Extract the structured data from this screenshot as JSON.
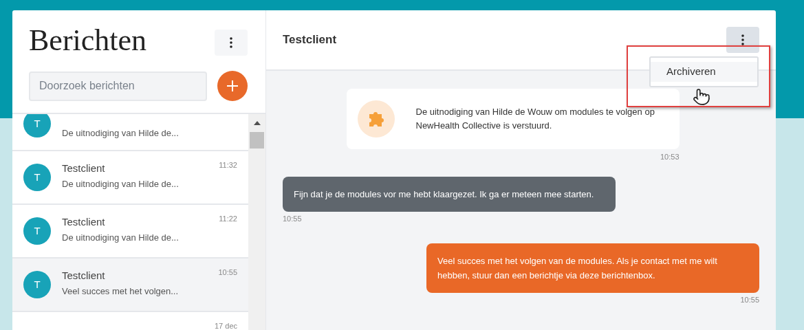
{
  "sidebar": {
    "title": "Berichten",
    "search": {
      "placeholder": "Doorzoek berichten"
    },
    "conversations": [
      {
        "avatar": "T",
        "preview": "De uitnodiging van Hilde de...",
        "selected": false
      },
      {
        "avatar": "T",
        "name": "Testclient",
        "preview": "De uitnodiging van Hilde de...",
        "time": "11:32",
        "selected": false
      },
      {
        "avatar": "T",
        "name": "Testclient",
        "preview": "De uitnodiging van Hilde de...",
        "time": "11:22",
        "selected": false
      },
      {
        "avatar": "T",
        "name": "Testclient",
        "preview": "Veel succes met het volgen...",
        "time": "10:55",
        "selected": true
      },
      {
        "time": "17 dec",
        "selected": false
      }
    ]
  },
  "chat": {
    "title": "Testclient",
    "menu": {
      "expanded": true,
      "highlighted": true,
      "items": [
        {
          "label": "Archiveren",
          "hovered": true
        }
      ]
    },
    "messages": [
      {
        "kind": "system",
        "text": "De uitnodiging van Hilde de Wouw om modules te volgen op NewHealth Collective is verstuurd.",
        "time": "10:53"
      },
      {
        "kind": "incoming",
        "text": "Fijn dat je de modules vor me hebt klaargezet. Ik ga er meteen mee starten.",
        "time": "10:55"
      },
      {
        "kind": "outgoing",
        "text": "Veel succes met het volgen van de modules. Als je contact met me wilt hebben, stuur dan een berichtje via deze berichtenbox.",
        "time": "10:55"
      }
    ]
  }
}
